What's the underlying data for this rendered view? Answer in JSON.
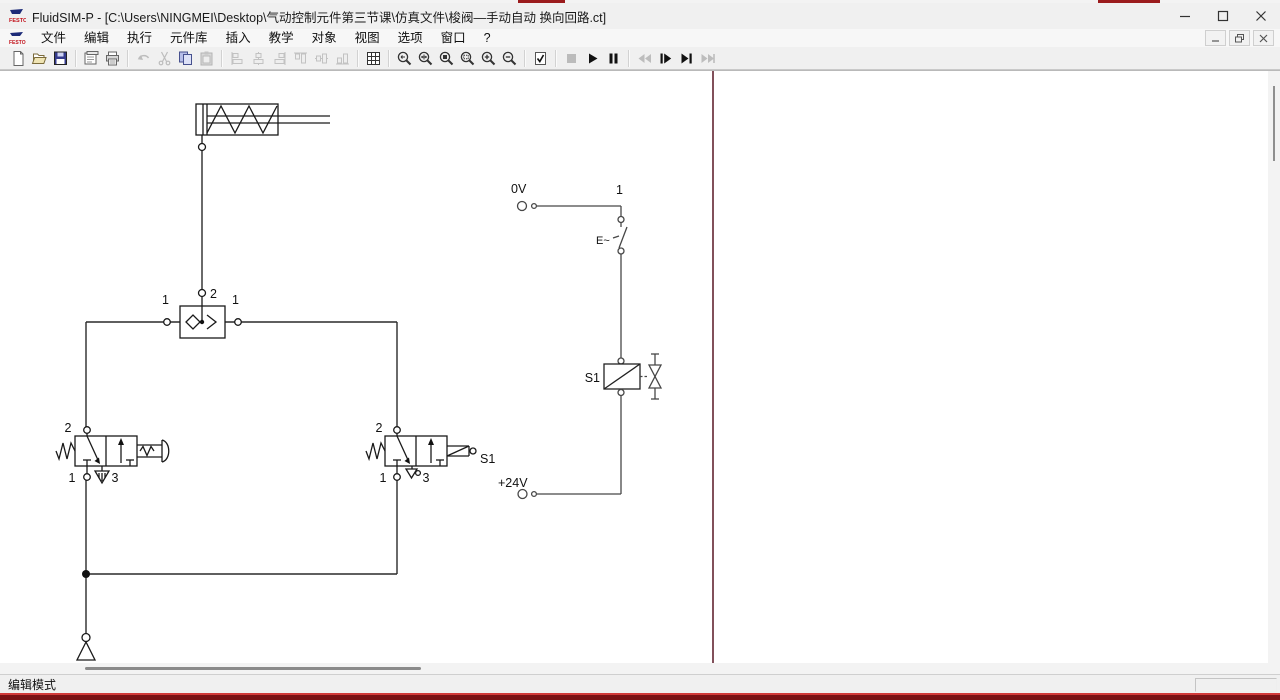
{
  "window": {
    "title": "FluidSIM-P - [C:\\Users\\NINGMEI\\Desktop\\气动控制元件第三节课\\仿真文件\\梭阀—手动自动 换向回路.ct]"
  },
  "menu": {
    "items": [
      "文件",
      "编辑",
      "执行",
      "元件库",
      "插入",
      "教学",
      "对象",
      "视图",
      "选项",
      "窗口",
      "?"
    ]
  },
  "toolbar": {
    "icon_names": [
      "new",
      "open",
      "save",
      "page-preview",
      "print",
      "undo",
      "cut",
      "copy",
      "paste",
      "align-left",
      "align-center",
      "align-right",
      "align-top",
      "align-middle",
      "align-bottom",
      "grid",
      "zoom-previous",
      "zoom-fit",
      "zoom-page",
      "zoom-rect",
      "zoom-in",
      "zoom-out",
      "check-circuit",
      "stop",
      "play",
      "pause",
      "rewind",
      "step-forward",
      "play-to-end",
      "fast-forward"
    ],
    "disabled_icons": [
      "undo",
      "cut",
      "paste",
      "align-left",
      "align-center",
      "align-right",
      "align-top",
      "align-middle",
      "align-bottom",
      "stop",
      "rewind",
      "fast-forward"
    ]
  },
  "statusbar": {
    "mode": "编辑模式"
  },
  "circuit": {
    "shuttle_valve": {
      "port_top": "2",
      "port_left": "1",
      "port_right": "1"
    },
    "valve_left": {
      "port_top": "2",
      "port_bottom": "1",
      "port_exhaust": "3"
    },
    "valve_right": {
      "port_top": "2",
      "port_bottom": "1",
      "port_exhaust": "3",
      "tag": "S1"
    },
    "electric": {
      "rail_top": "0V",
      "rail_bottom": "+24V",
      "branch": "1",
      "switch_tag": "E~",
      "coil_tag": "S1"
    }
  },
  "colors": {
    "page_border": "#82505a",
    "video_bar": "#7a1215",
    "wire": "#444444",
    "symbol": "#1a1a1a"
  }
}
